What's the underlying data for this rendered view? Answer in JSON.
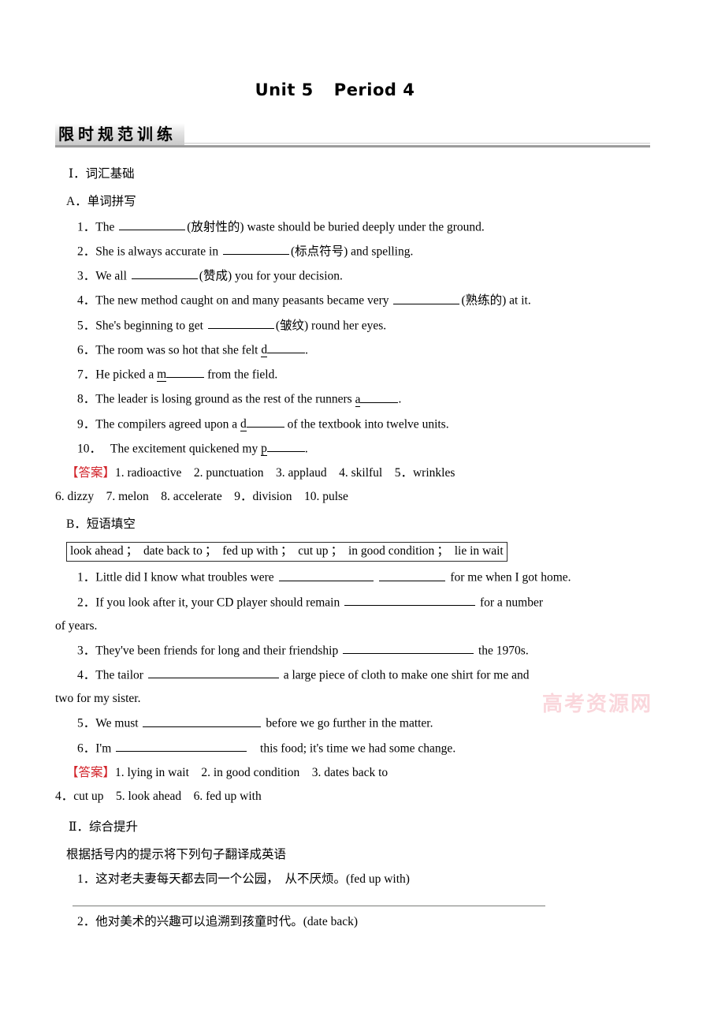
{
  "header": {
    "unit": "Unit 5",
    "period": "Period 4",
    "banner_title": "限时规范训练"
  },
  "watermark": "高考资源网",
  "section_i": {
    "heading": "Ⅰ．词汇基础",
    "part_a": {
      "heading": "A．单词拼写",
      "items": [
        {
          "num": "1．",
          "pre": "The",
          "hint": "(放射性的)",
          "post": "waste should be buried deeply under the ground.",
          "blank": "b-w3",
          "kind": "blank"
        },
        {
          "num": "2．",
          "pre": "She is always accurate in",
          "hint": "(标点符号)",
          "post": "and spelling.",
          "blank": "b-w3",
          "kind": "blank"
        },
        {
          "num": "3．",
          "pre": "We all",
          "hint": "(赞成)",
          "post": "you for your decision.",
          "blank": "b-w3",
          "kind": "blank"
        },
        {
          "num": "4．",
          "pre": "The new method caught on and many peasants became very",
          "hint": "(熟练的)",
          "post": "at it.",
          "blank": "b-w3",
          "kind": "blank"
        },
        {
          "num": "5．",
          "pre": "She's beginning to get",
          "hint": "(皱纹)",
          "post": "round her eyes.",
          "blank": "b-w3",
          "kind": "blank"
        },
        {
          "num": "6．",
          "pre": "The room was so hot that she felt",
          "letter": "d",
          "post": ".",
          "kind": "letter"
        },
        {
          "num": "7．",
          "pre": "He picked a",
          "letter": "m",
          "post": "from the field.",
          "kind": "letter"
        },
        {
          "num": "8．",
          "pre": "The leader is losing ground as the rest of the runners",
          "letter": "a",
          "post": ".",
          "kind": "letter"
        },
        {
          "num": "9．",
          "pre": "The compilers agreed upon a",
          "letter": "d",
          "post": "of the textbook into twelve units.",
          "kind": "letter"
        },
        {
          "num": "10．",
          "pre": "The excitement quickened my",
          "letter": "p",
          "post": ".",
          "kind": "letter"
        }
      ],
      "answer_tag": "【答案】",
      "answer_line1": "1. radioactive　2. punctuation　3. applaud　4. skilful　5．wrinkles",
      "answer_line2": "6. dizzy　7. melon　8. accelerate　9．division　10. pulse"
    },
    "part_b": {
      "heading": "B．短语填空",
      "bank": [
        "look ahead",
        "date back to",
        "fed up with",
        "cut up",
        "in good condition",
        "lie in wait"
      ],
      "bank_separator": "；",
      "items": [
        {
          "num": "1．",
          "pre": "Little did I know what troubles were",
          "post": "for me when I got home.",
          "kind": "double"
        },
        {
          "num": "2．",
          "pre": "If you look after it, your CD player should remain",
          "post": "for a number",
          "cont": "of years.",
          "kind": "long"
        },
        {
          "num": "3．",
          "pre": "They've been friends for long and their friendship",
          "post": "the 1970s.",
          "kind": "long"
        },
        {
          "num": "4．",
          "pre": "The tailor",
          "post": "a large piece of cloth to make one shirt for me and",
          "cont": "two for my sister.",
          "kind": "long"
        },
        {
          "num": "5．",
          "pre": "We must",
          "post": "before we go further in the matter.",
          "kind": "long"
        },
        {
          "num": "6．",
          "pre": "I'm",
          "post": "this food; it's time we had some change.",
          "kind": "long"
        }
      ],
      "answer_tag": "【答案】",
      "answer_line1": "1. lying in wait　2. in good condition　3. dates back to",
      "answer_line2": "4．cut up　5. look ahead　6. fed up with"
    }
  },
  "section_ii": {
    "heading": "Ⅱ．综合提升",
    "instruction": "根据括号内的提示将下列句子翻译成英语",
    "items": [
      {
        "num": "1．",
        "text": "这对老夫妻每天都去同一个公园，　从不厌烦。(fed up with)"
      },
      {
        "num": "2．",
        "text": "他对美术的兴趣可以追溯到孩童时代。(date back)"
      }
    ]
  }
}
